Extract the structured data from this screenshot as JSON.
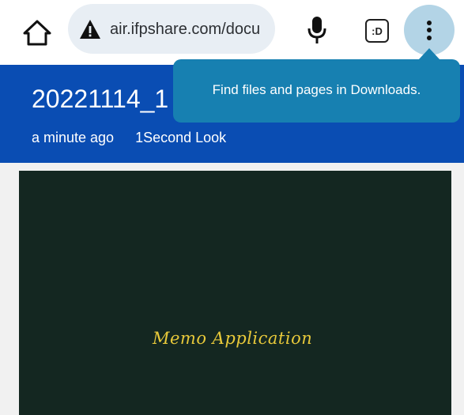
{
  "toolbar": {
    "url": "air.ifpshare.com/docu",
    "tab_switcher_label": ":D"
  },
  "header": {
    "title": "20221114_1",
    "time": "a minute ago",
    "views": "1Second Look"
  },
  "tooltip": {
    "text": "Find files and pages in Downloads."
  },
  "preview": {
    "caption": "Memo Application"
  },
  "colors": {
    "header_bg": "#0a4db3",
    "tooltip_bg": "#1780b1",
    "menu_highlight": "#b3d4e6",
    "omnibox_bg": "#e8eef4",
    "board_bg": "#142721",
    "memo_text": "#e8c93a"
  },
  "icons": [
    "home-icon",
    "warning-icon",
    "mic-icon",
    "tab-switcher-icon",
    "more-vert-icon"
  ]
}
